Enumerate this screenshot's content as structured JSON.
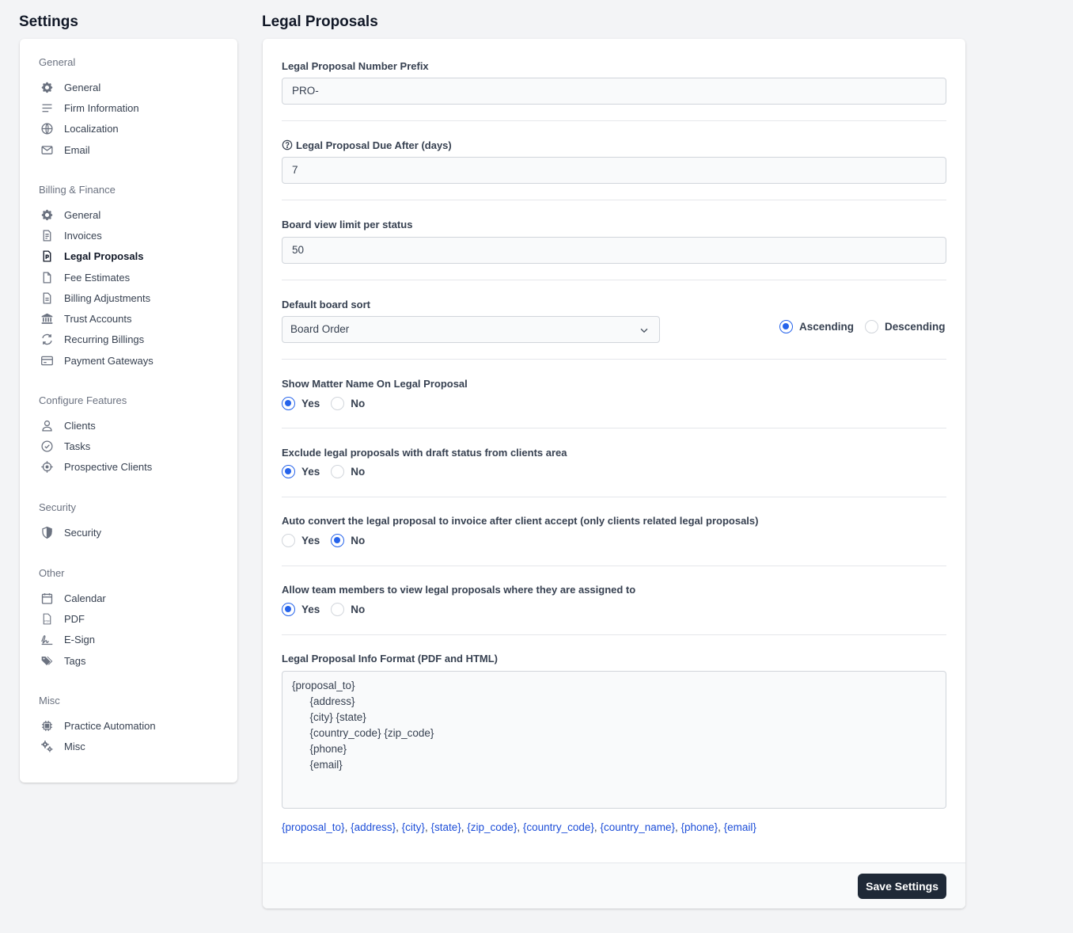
{
  "sidebar": {
    "title": "Settings",
    "groups": [
      {
        "heading": "General",
        "items": [
          {
            "label": "General",
            "icon": "gear-icon"
          },
          {
            "label": "Firm Information",
            "icon": "lines-icon"
          },
          {
            "label": "Localization",
            "icon": "globe-icon"
          },
          {
            "label": "Email",
            "icon": "envelope-icon"
          }
        ]
      },
      {
        "heading": "Billing & Finance",
        "items": [
          {
            "label": "General",
            "icon": "gear-icon"
          },
          {
            "label": "Invoices",
            "icon": "invoice-icon"
          },
          {
            "label": "Legal Proposals",
            "icon": "proposal-icon",
            "active": true
          },
          {
            "label": "Fee Estimates",
            "icon": "document-icon"
          },
          {
            "label": "Billing Adjustments",
            "icon": "document-text-icon"
          },
          {
            "label": "Trust Accounts",
            "icon": "bank-icon"
          },
          {
            "label": "Recurring Billings",
            "icon": "refresh-icon"
          },
          {
            "label": "Payment Gateways",
            "icon": "credit-card-icon"
          }
        ]
      },
      {
        "heading": "Configure Features",
        "items": [
          {
            "label": "Clients",
            "icon": "user-icon"
          },
          {
            "label": "Tasks",
            "icon": "check-circle-icon"
          },
          {
            "label": "Prospective Clients",
            "icon": "crosshair-icon"
          }
        ]
      },
      {
        "heading": "Security",
        "items": [
          {
            "label": "Security",
            "icon": "shield-icon"
          }
        ]
      },
      {
        "heading": "Other",
        "items": [
          {
            "label": "Calendar",
            "icon": "calendar-icon"
          },
          {
            "label": "PDF",
            "icon": "pdf-icon"
          },
          {
            "label": "E-Sign",
            "icon": "signature-icon"
          },
          {
            "label": "Tags",
            "icon": "tags-icon"
          }
        ]
      },
      {
        "heading": "Misc",
        "items": [
          {
            "label": "Practice Automation",
            "icon": "chip-icon"
          },
          {
            "label": "Misc",
            "icon": "cogs-icon"
          }
        ]
      }
    ]
  },
  "main": {
    "title": "Legal Proposals",
    "prefix": {
      "label": "Legal Proposal Number Prefix",
      "value": "PRO-"
    },
    "due_after": {
      "label": "Legal Proposal Due After (days)",
      "value": "7"
    },
    "board_limit": {
      "label": "Board view limit per status",
      "value": "50"
    },
    "board_sort": {
      "label": "Default board sort",
      "selected": "Board Order",
      "asc_label": "Ascending",
      "desc_label": "Descending",
      "direction": "ascending"
    },
    "show_matter": {
      "label": "Show Matter Name On Legal Proposal",
      "yes": "Yes",
      "no": "No",
      "value": "yes"
    },
    "exclude_draft": {
      "label": "Exclude legal proposals with draft status from clients area",
      "yes": "Yes",
      "no": "No",
      "value": "yes"
    },
    "auto_convert": {
      "label": "Auto convert the legal proposal to invoice after client accept (only clients related legal proposals)",
      "yes": "Yes",
      "no": "No",
      "value": "no"
    },
    "team_view": {
      "label": "Allow team members to view legal proposals where they are assigned to",
      "yes": "Yes",
      "no": "No",
      "value": "yes"
    },
    "info_format": {
      "label": "Legal Proposal Info Format (PDF and HTML)",
      "value": "{proposal_to}\n      {address}\n      {city} {state}\n      {country_code} {zip_code}\n      {phone}\n      {email}",
      "placeholders": [
        "{proposal_to}",
        "{address}",
        "{city}",
        "{state}",
        "{zip_code}",
        "{country_code}",
        "{country_name}",
        "{phone}",
        "{email}"
      ]
    },
    "save_label": "Save Settings"
  },
  "colors": {
    "accent": "#2563eb",
    "link": "#1d4ed8",
    "button": "#1f2937"
  }
}
